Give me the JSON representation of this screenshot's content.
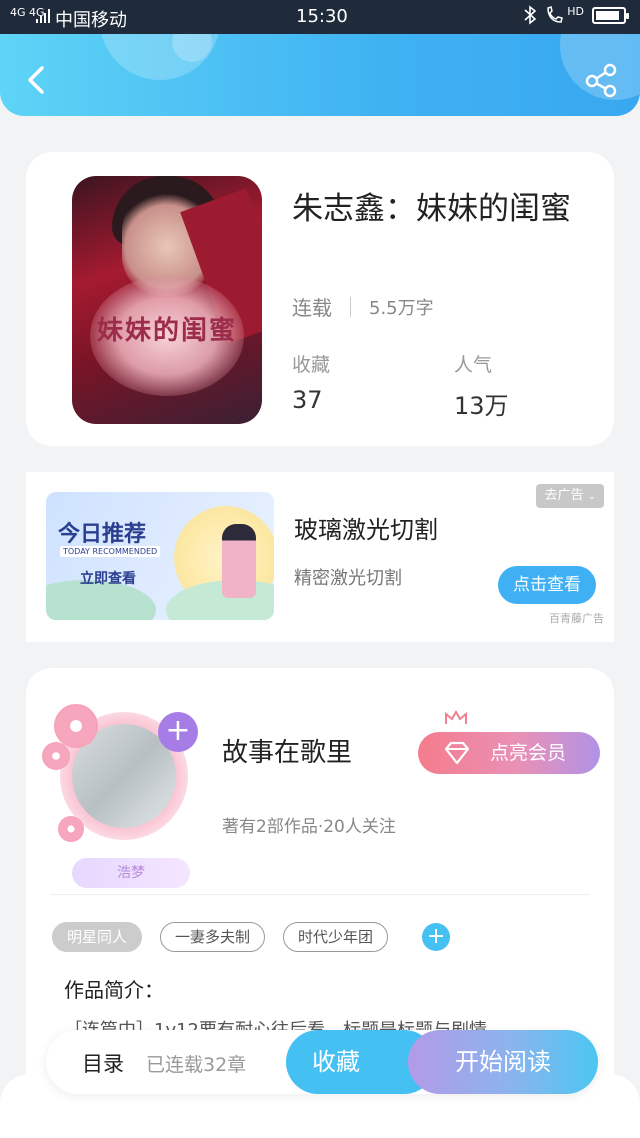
{
  "status_bar": {
    "signal": "4G 4G",
    "carrier": "中国移动",
    "time": "15:30",
    "hd": "HD",
    "battery_level": 0.75
  },
  "header": {
    "back_icon": "chevron-left-icon",
    "share_icon": "share-icon"
  },
  "book": {
    "title": "朱志鑫：妹妹的闺蜜",
    "cover_text": "妹妹的闺蜜",
    "status": "连载",
    "word_count": "5.5万字",
    "collect_label": "收藏",
    "collect_value": "37",
    "popularity_label": "人气",
    "popularity_value": "13万"
  },
  "ad": {
    "image_title": "今日推荐",
    "image_subtitle": "TODAY RECOMMENDED",
    "image_cta": "立即查看",
    "remove_label": "去广告",
    "title": "玻璃激光切割",
    "subtitle": "精密激光切割",
    "button": "点击查看",
    "source": "百青藤广告"
  },
  "author": {
    "name": "故事在歌里",
    "badge": "浩梦",
    "vip_button": "点亮会员",
    "stats": "著有2部作品·20人关注",
    "tags": [
      "明星同人",
      "一妻多夫制",
      "时代少年团"
    ],
    "intro_label": "作品简介：",
    "intro_text": "［连篇中］1v12要有耐心往后看，标题是标题与剧情"
  },
  "bottom_bar": {
    "toc_label": "目录",
    "toc_count": "已连载32章",
    "favorite_button": "收藏",
    "read_button": "开始阅读"
  },
  "colors": {
    "accent_blue": "#45c0f3",
    "header_gradient_start": "#5ed4f6",
    "header_gradient_end": "#38a8f0",
    "vip_gradient_start": "#f47c8c",
    "vip_gradient_end": "#b192e6"
  }
}
